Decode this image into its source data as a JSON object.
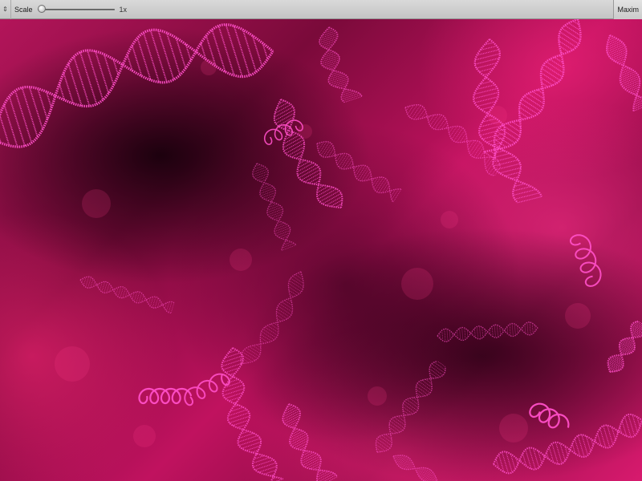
{
  "toolbar": {
    "menu_icon": "drag-handle-icon",
    "scale_label": "Scale",
    "scale_slider": {
      "value": 0
    },
    "scale_value": "1x",
    "maximize_label": "Maxim"
  },
  "viewport": {
    "scene": "dna-helix-particles",
    "colors": {
      "background": "#b3155a",
      "shadow": "#1a000c",
      "helix": "#ff4fc8"
    }
  }
}
